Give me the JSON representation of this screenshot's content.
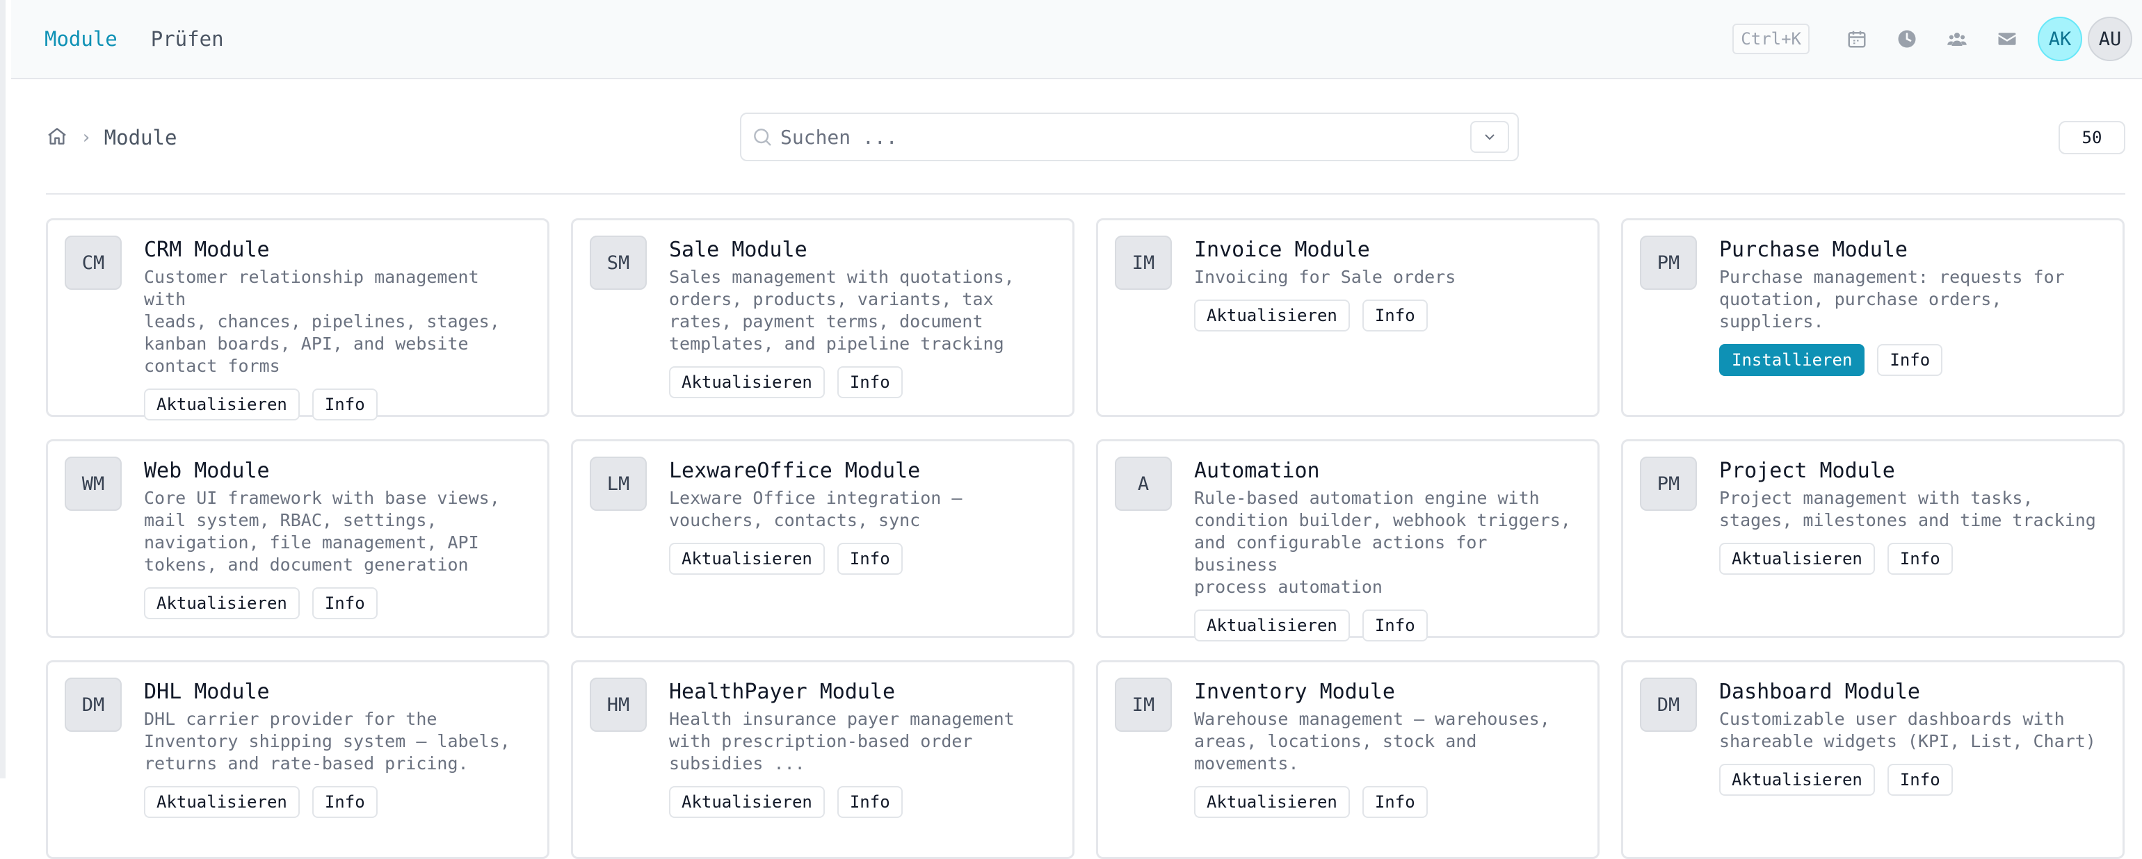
{
  "topnav": {
    "modules": "Module",
    "review": "Prüfen",
    "shortcut": "Ctrl+K",
    "user_initials": "AK",
    "user2_initials": "AU"
  },
  "breadcrumb": {
    "current": "Module"
  },
  "search": {
    "placeholder": "Suchen ..."
  },
  "page_size": "50",
  "colors": {
    "accent": "#0e91b5",
    "avatar": "#a5f3fc"
  },
  "buttons": {
    "update": "Aktualisieren",
    "info": "Info",
    "install": "Installieren"
  },
  "modules": [
    {
      "code": "CM",
      "name": "CRM Module",
      "desc": "Customer relationship management with\nleads, chances, pipelines, stages,\nkanban boards, API, and website\ncontact forms",
      "primary": "update"
    },
    {
      "code": "SM",
      "name": "Sale Module",
      "desc": "Sales management with quotations,\norders, products, variants, tax\nrates, payment terms, document\ntemplates, and pipeline tracking",
      "primary": "update"
    },
    {
      "code": "IM",
      "name": "Invoice Module",
      "desc": "Invoicing for Sale orders",
      "primary": "update"
    },
    {
      "code": "PM",
      "name": "Purchase Module",
      "desc": "Purchase management: requests for\nquotation, purchase orders,\nsuppliers.",
      "primary": "install"
    },
    {
      "code": "WM",
      "name": "Web Module",
      "desc": "Core UI framework with base views,\nmail system, RBAC, settings,\nnavigation, file management, API\ntokens, and document generation",
      "primary": "update"
    },
    {
      "code": "LM",
      "name": "LexwareOffice Module",
      "desc": "Lexware Office integration —\nvouchers, contacts, sync",
      "primary": "update"
    },
    {
      "code": "A",
      "name": "Automation",
      "desc": "Rule-based automation engine with\ncondition builder, webhook triggers,\nand configurable actions for business\nprocess automation",
      "primary": "update"
    },
    {
      "code": "PM",
      "name": "Project Module",
      "desc": "Project management with tasks,\nstages, milestones and time tracking",
      "primary": "update"
    },
    {
      "code": "DM",
      "name": "DHL Module",
      "desc": "DHL carrier provider for the\nInventory shipping system — labels,\nreturns and rate-based pricing.",
      "primary": "update"
    },
    {
      "code": "HM",
      "name": "HealthPayer Module",
      "desc": "Health insurance payer management\nwith prescription-based order\nsubsidies ...",
      "primary": "update"
    },
    {
      "code": "IM",
      "name": "Inventory Module",
      "desc": "Warehouse management — warehouses,\nareas, locations, stock and\nmovements.",
      "primary": "update"
    },
    {
      "code": "DM",
      "name": "Dashboard Module",
      "desc": "Customizable user dashboards with\nshareable widgets (KPI, List, Chart)",
      "primary": "update"
    }
  ]
}
